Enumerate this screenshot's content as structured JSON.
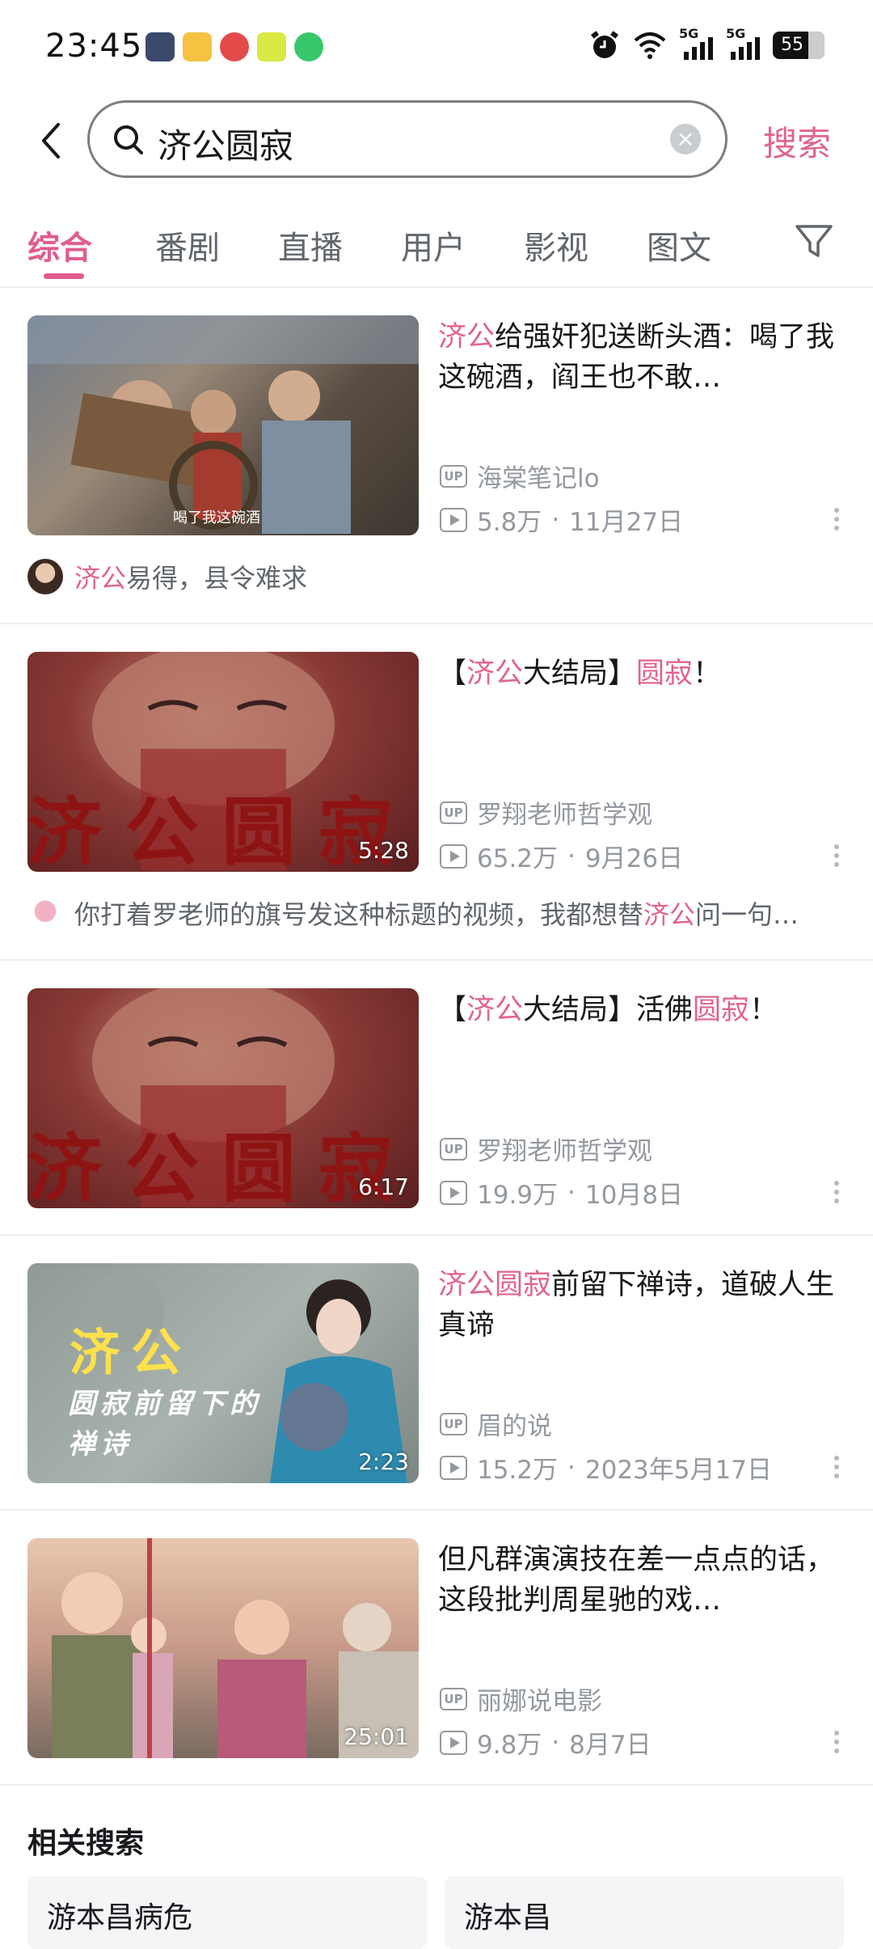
{
  "status_bar": {
    "time": "23:45",
    "network1": "5G",
    "network2": "5G",
    "battery": "55"
  },
  "search": {
    "query": "济公圆寂",
    "button_label": "搜索",
    "clear_label": "×"
  },
  "tabs": [
    {
      "label": "综合",
      "active": true
    },
    {
      "label": "番剧"
    },
    {
      "label": "直播"
    },
    {
      "label": "用户"
    },
    {
      "label": "影视"
    },
    {
      "label": "图文"
    }
  ],
  "videos": [
    {
      "title_parts": [
        {
          "text": "济公",
          "hl": true
        },
        {
          "text": "给强奸犯送断头酒：喝了我这碗酒，阎王也不敢…",
          "hl": false
        }
      ],
      "uploader": "海棠笔记lo",
      "views": "5.8万",
      "date": "11月27日",
      "duration": "",
      "thumb_caption": "喝了我这碗酒",
      "comment_parts": [
        {
          "text": "济公",
          "hl": true
        },
        {
          "text": "易得，县令难求",
          "hl": false
        }
      ]
    },
    {
      "title_parts": [
        {
          "text": "【",
          "hl": false
        },
        {
          "text": "济公",
          "hl": true
        },
        {
          "text": "大结局】",
          "hl": false
        },
        {
          "text": "圆寂",
          "hl": true
        },
        {
          "text": "！",
          "hl": false
        }
      ],
      "uploader": "罗翔老师哲学观",
      "views": "65.2万",
      "date": "9月26日",
      "duration": "5:28",
      "thumb_caption": "济公圆寂",
      "comment_parts": [
        {
          "text": "你打着罗老师的旗号发这种标题的视频，我都想替",
          "hl": false
        },
        {
          "text": "济公",
          "hl": true
        },
        {
          "text": "问一句…",
          "hl": false
        }
      ]
    },
    {
      "title_parts": [
        {
          "text": "【",
          "hl": false
        },
        {
          "text": "济公",
          "hl": true
        },
        {
          "text": "大结局】活佛",
          "hl": false
        },
        {
          "text": "圆寂",
          "hl": true
        },
        {
          "text": "！",
          "hl": false
        }
      ],
      "uploader": "罗翔老师哲学观",
      "views": "19.9万",
      "date": "10月8日",
      "duration": "6:17",
      "thumb_caption": "济公圆寂"
    },
    {
      "title_parts": [
        {
          "text": "济公圆寂",
          "hl": true
        },
        {
          "text": "前留下禅诗，道破人生真谛",
          "hl": false
        }
      ],
      "uploader": "眉的说",
      "views": "15.2万",
      "date": "2023年5月17日",
      "duration": "2:23",
      "thumb_caption": "济公",
      "thumb_caption2": "圆寂前留下的",
      "thumb_caption3": "禅诗"
    },
    {
      "title_parts": [
        {
          "text": "但凡群演演技在差一点点的话，这段批判周星驰的戏…",
          "hl": false
        }
      ],
      "uploader": "丽娜说电影",
      "views": "9.8万",
      "date": "8月7日",
      "duration": "25:01"
    }
  ],
  "related": {
    "title": "相关搜索",
    "items": [
      "游本昌病危",
      "游本昌"
    ]
  },
  "labels": {
    "up": "UP",
    "dot": "·"
  },
  "colors": {
    "accent": "#e05d8f",
    "meta": "#9499a0"
  }
}
